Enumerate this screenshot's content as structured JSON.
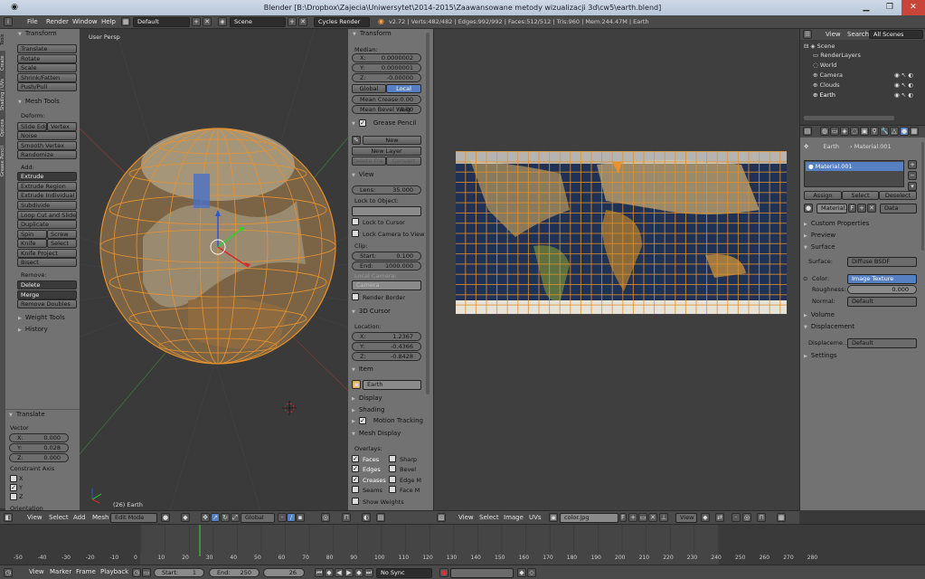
{
  "window": {
    "title": "Blender [B:\\Dropbox\\Zajecia\\Uniwersytet\\2014-2015\\Zaawansowane metody wizualizacji 3d\\cw5\\earth.blend]"
  },
  "info": {
    "menus": [
      "File",
      "Render",
      "Window",
      "Help"
    ],
    "screen": "Default",
    "scene": "Scene",
    "engine": "Cycles Render",
    "stats": "v2.72 | Verts:482/482 | Edges:992/992 | Faces:512/512 | Tris:960 | Mem:244.47M | Earth"
  },
  "tool_tabs": [
    "Tools",
    "Create",
    "Shading / UVs",
    "Options",
    "Grease Pencil"
  ],
  "tools": {
    "transform_header": "Transform",
    "transform": [
      "Translate",
      "Rotate",
      "Scale",
      "Shrink/Fatten",
      "Push/Pull"
    ],
    "mesh_tools_header": "Mesh Tools",
    "deform_label": "Deform:",
    "slide_edge": "Slide Edg",
    "vertex": "Vertex",
    "noise": "Noise",
    "smooth_vertex": "Smooth Vertex",
    "randomize": "Randomize",
    "add_label": "Add:",
    "extrude": "Extrude",
    "extrude_region": "Extrude Region",
    "extrude_individual": "Extrude Individual",
    "subdivide": "Subdivide",
    "loop_cut": "Loop Cut and Slide",
    "duplicate": "Duplicate",
    "spin": "Spin",
    "screw": "Screw",
    "knife": "Knife",
    "select": "Select",
    "knife_project": "Knife Project",
    "bisect": "Bisect",
    "remove_label": "Remove:",
    "delete": "Delete",
    "merge": "Merge",
    "remove_doubles": "Remove Doubles",
    "weight_tools": "Weight Tools",
    "history": "History"
  },
  "operator": {
    "header": "Translate",
    "vector_label": "Vector",
    "x_label": "X:",
    "x": "0.000",
    "y_label": "Y:",
    "y": "0.028",
    "z_label": "Z:",
    "z": "0.000",
    "constraint_label": "Constraint Axis",
    "axes": [
      "X",
      "Y",
      "Z"
    ],
    "orientation_label": "Orientation"
  },
  "viewport": {
    "label": "User Persp",
    "object_label": "(26) Earth"
  },
  "properties_n": {
    "transform_header": "Transform",
    "median_label": "Median:",
    "x_label": "X:",
    "x": "0.0000002",
    "y_label": "Y:",
    "y": "0.0000001",
    "z_label": "Z:",
    "z": "-0.00000",
    "global": "Global",
    "local": "Local",
    "mean_crease_label": "Mean Crease:",
    "mean_crease": "0.00",
    "mean_bevel_label": "Mean Bevel Weig:",
    "mean_bevel": "0.00",
    "grease_header": "Grease Pencil",
    "new": "New",
    "new_layer": "New Layer",
    "delete_frame": "Delete Fra...",
    "convert": "Convert",
    "view_header": "View",
    "lens_label": "Lens:",
    "lens": "35.000",
    "lock_label": "Lock to Object:",
    "lock_cursor": "Lock to Cursor",
    "lock_camera": "Lock Camera to View",
    "clip_label": "Clip:",
    "start_label": "Start:",
    "start": "0.100",
    "end_label": "End:",
    "end": "1000.000",
    "local_camera": "Local Camera:",
    "camera": "Camera",
    "render_border": "Render Border",
    "cursor_header": "3D Cursor",
    "location_label": "Location:",
    "cx_label": "X:",
    "cx": "1.2367",
    "cy_label": "Y:",
    "cy": "-0.4366",
    "cz_label": "Z:",
    "cz": "-0.8428",
    "item_header": "Item",
    "item_name": "Earth",
    "display_header": "Display",
    "shading_header": "Shading",
    "motion_header": "Motion Tracking",
    "mesh_display_header": "Mesh Display",
    "overlays_label": "Overlays:",
    "overlays_left": [
      "Faces",
      "Edges",
      "Creases",
      "Seams"
    ],
    "overlays_right": [
      "Sharp",
      "Bevel",
      "Edge M",
      "Face M"
    ],
    "show_weights": "Show Weights"
  },
  "view3d_header": {
    "menus": [
      "View",
      "Select",
      "Add",
      "Mesh"
    ],
    "mode": "Edit Mode",
    "orientation": "Global"
  },
  "uv_header": {
    "menus": [
      "View",
      "Select",
      "Image",
      "UVs"
    ],
    "image": "color.jpg",
    "image_flag": "F",
    "view": "View"
  },
  "outliner": {
    "tabs": [
      "View",
      "Search",
      "All Scenes"
    ],
    "items": [
      "Scene",
      "RenderLayers",
      "World",
      "Camera",
      "Clouds",
      "Earth"
    ]
  },
  "props": {
    "breadcrumb": [
      "Earth",
      "Material.001"
    ],
    "material_slot": "Material.001",
    "assign": "Assign",
    "select": "Select",
    "deselect": "Deselect",
    "material_name": "Material.",
    "material_flag": "F",
    "data": "Data",
    "sections": {
      "custom": "Custom Properties",
      "preview": "Preview",
      "surface": "Surface",
      "volume": "Volume",
      "displacement": "Displacement",
      "settings": "Settings"
    },
    "surface_label": "Surface:",
    "surface_value": "Diffuse BSDF",
    "color_label": "Color:",
    "color_value": "Image Texture",
    "roughness_label": "Roughness:",
    "roughness_value": "0.000",
    "normal_label": "Normal:",
    "normal_value": "Default",
    "displacement_label": "Displaceme...",
    "displacement_value": "Default"
  },
  "timeline": {
    "ticks": [
      "-50",
      "-40",
      "-30",
      "-20",
      "-10",
      "0",
      "10",
      "20",
      "30",
      "40",
      "50",
      "60",
      "70",
      "80",
      "90",
      "100",
      "110",
      "120",
      "130",
      "140",
      "150",
      "160",
      "170",
      "180",
      "190",
      "200",
      "210",
      "220",
      "230",
      "240",
      "250",
      "260",
      "270",
      "280"
    ],
    "menus": [
      "View",
      "Marker",
      "Frame",
      "Playback"
    ],
    "start_label": "Start:",
    "start": "1",
    "end_label": "End:",
    "end": "250",
    "current": "26",
    "sync": "No Sync"
  },
  "colors": {
    "accent": "#5680c2",
    "orange": "#f4a23a",
    "grid": "#3d3d3d"
  }
}
